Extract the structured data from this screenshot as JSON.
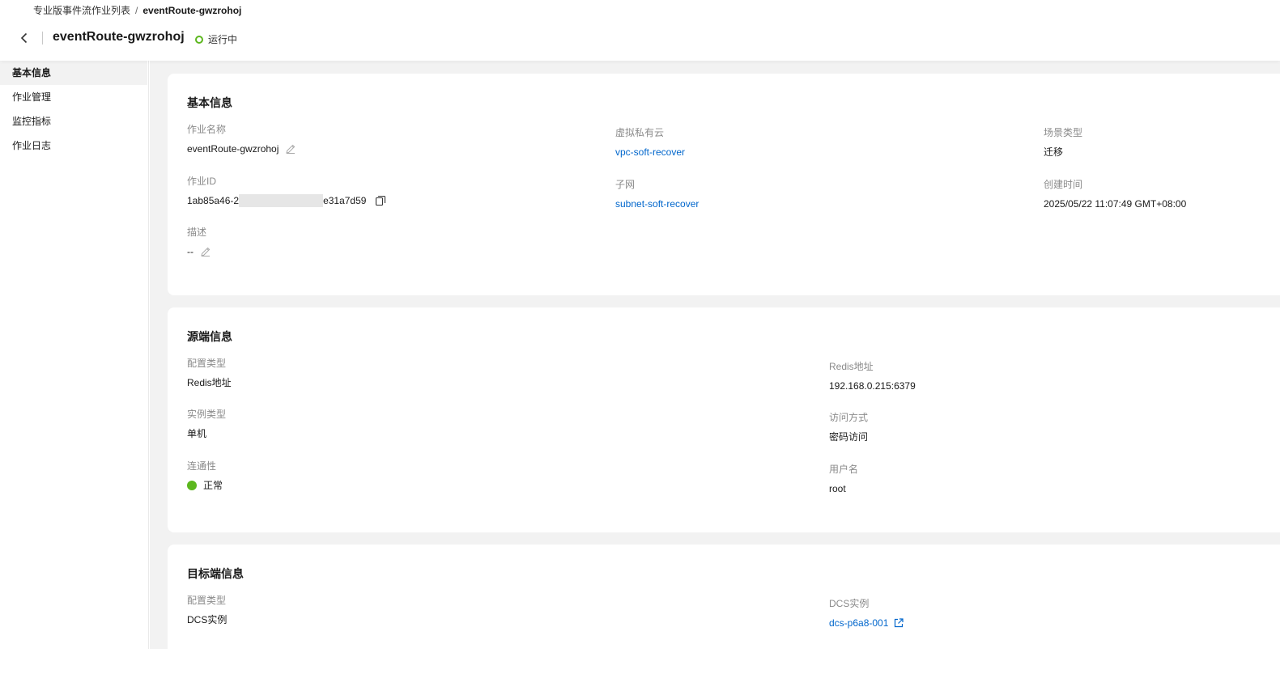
{
  "breadcrumb": {
    "parent": "专业版事件流作业列表",
    "separator": "/",
    "current": "eventRoute-gwzrohoj"
  },
  "header": {
    "title": "eventRoute-gwzrohoj",
    "status": "运行中",
    "status_color": "#5cb71e"
  },
  "sidebar": {
    "items": [
      {
        "label": "基本信息"
      },
      {
        "label": "作业管理"
      },
      {
        "label": "监控指标"
      },
      {
        "label": "作业日志"
      }
    ]
  },
  "basic": {
    "title": "基本信息",
    "job_name_label": "作业名称",
    "job_name": "eventRoute-gwzrohoj",
    "job_id_label": "作业ID",
    "job_id_prefix": "1ab85a46-2",
    "job_id_suffix": "e31a7d59",
    "desc_label": "描述",
    "desc": "--",
    "vpc_label": "虚拟私有云",
    "vpc": "vpc-soft-recover",
    "subnet_label": "子网",
    "subnet": "subnet-soft-recover",
    "scene_label": "场景类型",
    "scene": "迁移",
    "created_label": "创建时间",
    "created": "2025/05/22 11:07:49 GMT+08:00"
  },
  "source": {
    "title": "源端信息",
    "config_type_label": "配置类型",
    "config_type": "Redis地址",
    "instance_type_label": "实例类型",
    "instance_type": "单机",
    "connectivity_label": "连通性",
    "connectivity": "正常",
    "redis_addr_label": "Redis地址",
    "redis_addr": "192.168.0.215:6379",
    "access_label": "访问方式",
    "access": "密码访问",
    "username_label": "用户名",
    "username": "root"
  },
  "target": {
    "title": "目标端信息",
    "config_type_label": "配置类型",
    "config_type": "DCS实例",
    "dcs_label": "DCS实例",
    "dcs": "dcs-p6a8-001"
  },
  "colors": {
    "link": "#0066cc",
    "success": "#5cb71e"
  }
}
